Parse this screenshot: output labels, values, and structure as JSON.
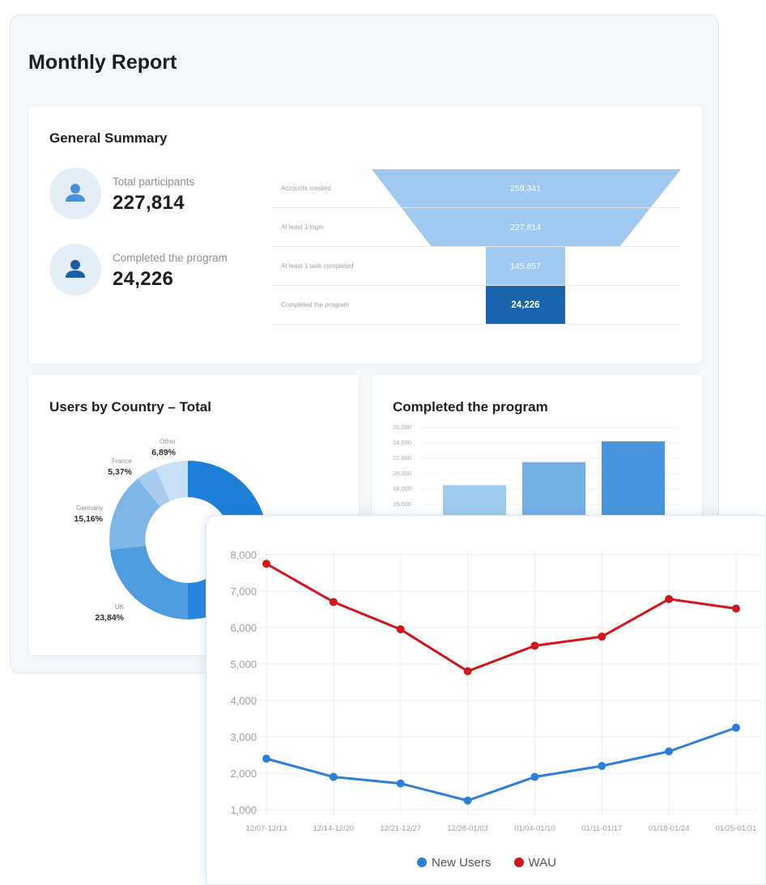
{
  "report": {
    "title": "Monthly Report"
  },
  "summary": {
    "title": "General Summary",
    "stats": [
      {
        "label": "Total participants",
        "value": "227,814",
        "icon": "user-icon"
      },
      {
        "label": "Completed the program",
        "value": "24,226",
        "icon": "user-icon"
      }
    ],
    "funnel": [
      {
        "label": "Accounts created",
        "value": "259,341"
      },
      {
        "label": "At least 1 login",
        "value": "227,814"
      },
      {
        "label": "At least 1 task completed",
        "value": "145,857"
      },
      {
        "label": "Completed the program",
        "value": "24,226"
      }
    ]
  },
  "country": {
    "title": "Users by Country – Total",
    "slices": [
      {
        "label": "Other",
        "pct": "6,89%",
        "value": 6.89
      },
      {
        "label": "France",
        "pct": "5,37%",
        "value": 5.37
      },
      {
        "label": "Germany",
        "pct": "15,16%",
        "value": 15.16
      },
      {
        "label": "UK",
        "pct": "23,84%",
        "value": 23.84
      }
    ],
    "colors": {
      "dark": "#1e7fd9",
      "mid": "#4f9be0",
      "light": "#7fb6e8",
      "lighter": "#a6cdf0",
      "lightest": "#c8e0f5"
    }
  },
  "completed": {
    "title": "Completed the program",
    "y_ticks": [
      "26,000",
      "24,000",
      "22,000",
      "20,000",
      "18,000",
      "16,000"
    ],
    "bars": [
      18500,
      21500,
      24200
    ],
    "colors": [
      "#9fcbef",
      "#73b0e6",
      "#4a96de"
    ]
  },
  "chart_data": {
    "type": "line",
    "x": [
      "12/07-12/13",
      "12/14-12/20",
      "12/21-12/27",
      "12/28-01/03",
      "01/04-01/10",
      "01/11-01/17",
      "01/18-01/24",
      "01/25-01/31"
    ],
    "series": [
      {
        "name": "New Users",
        "color": "#2b7fd6",
        "values": [
          2400,
          1900,
          1720,
          1250,
          1900,
          2200,
          2600,
          3250
        ]
      },
      {
        "name": "WAU",
        "color": "#d0151b",
        "values": [
          7750,
          6700,
          5950,
          4800,
          5500,
          5750,
          6780,
          6520
        ]
      }
    ],
    "y_ticks": [
      "8,000",
      "7,000",
      "6,000",
      "5,000",
      "4,000",
      "3,000",
      "2,000",
      "1,000"
    ],
    "ylim": [
      1000,
      8000
    ],
    "grid": true,
    "legend": "bottom"
  }
}
